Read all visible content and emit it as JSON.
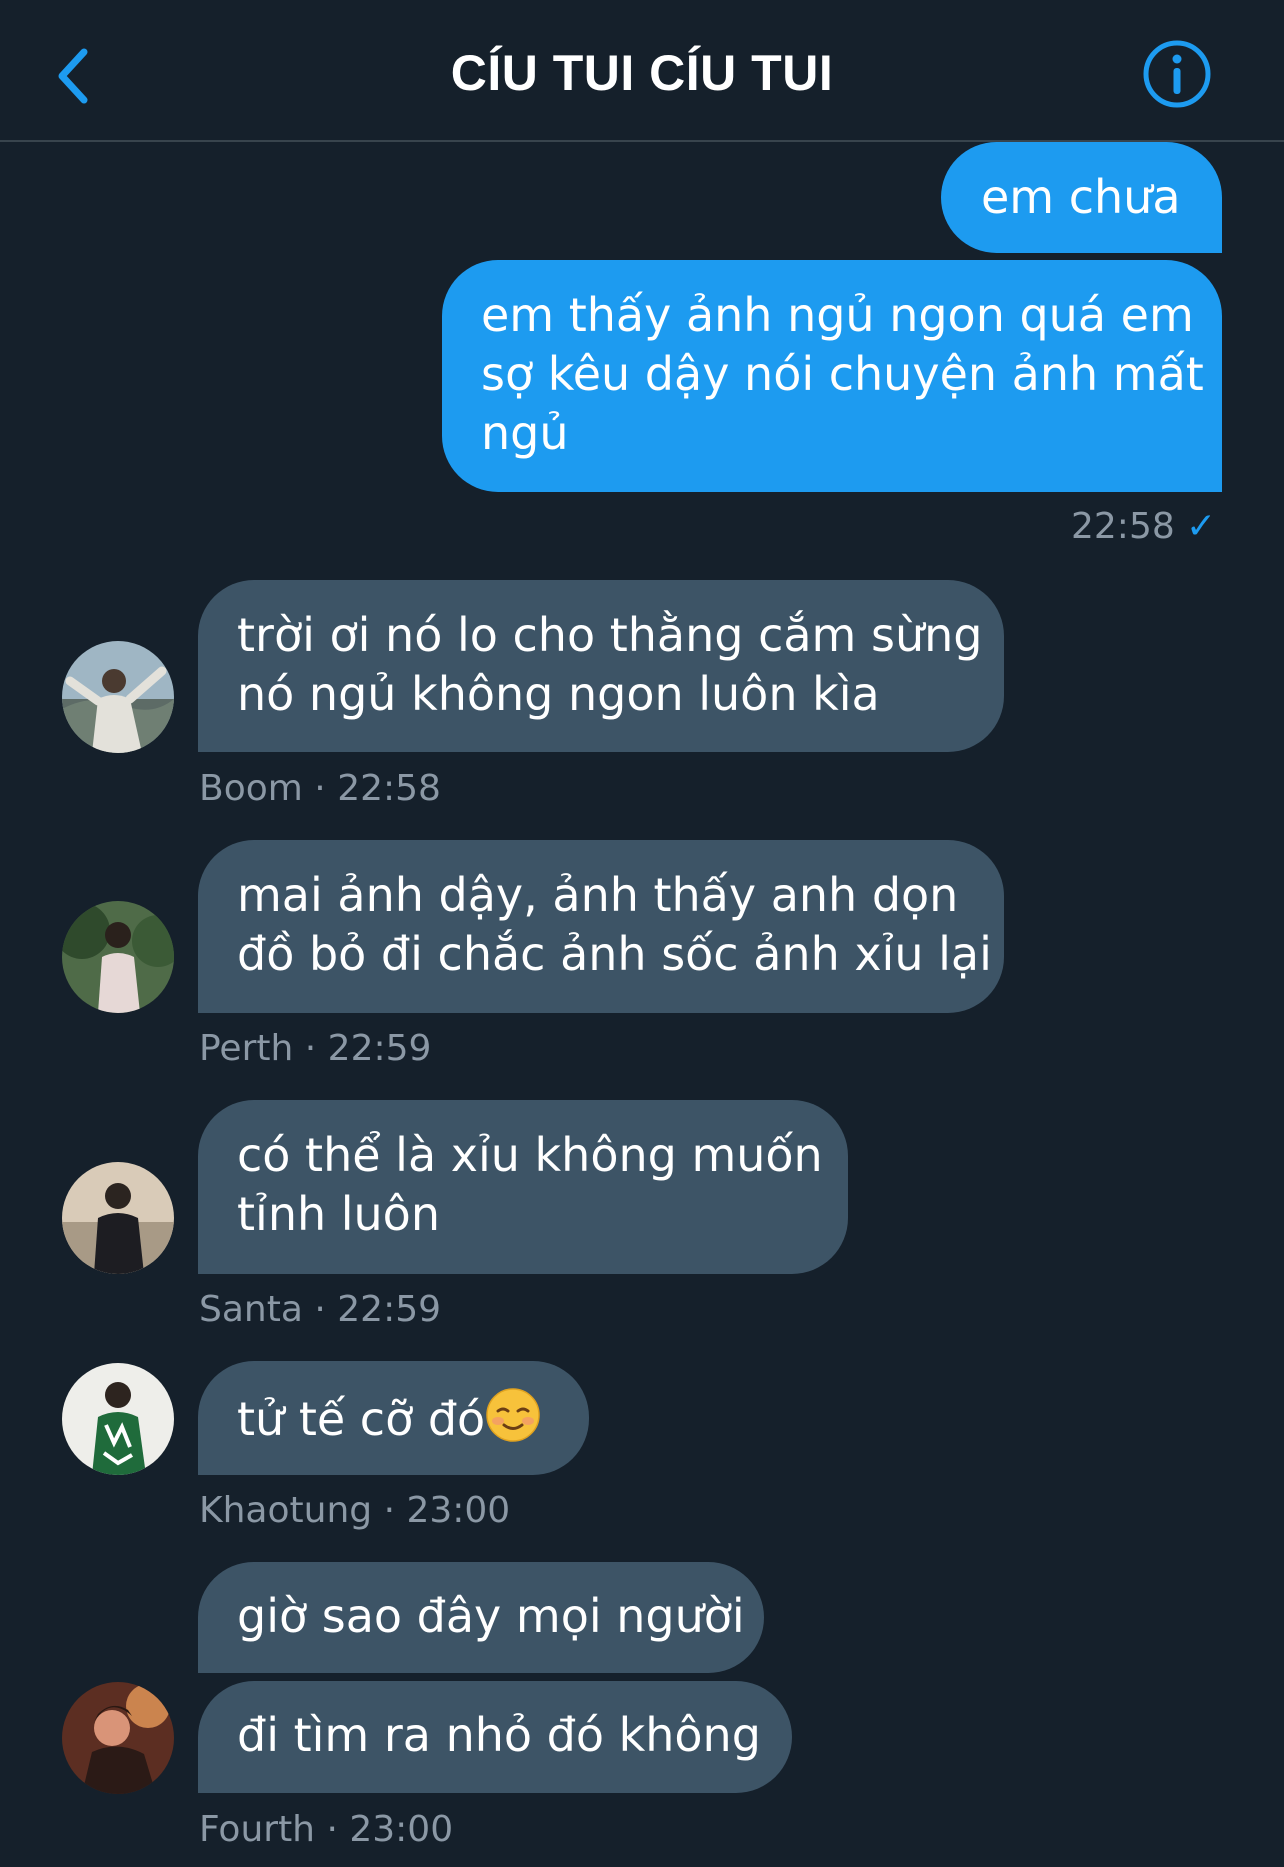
{
  "header": {
    "title": "CÍU TUI CÍU TUI"
  },
  "icons": {
    "back": "chevron-left-icon",
    "info": "info-circle-icon"
  },
  "colors": {
    "background": "#15202b",
    "outgoing": "#1d9bf0",
    "incoming": "#3d5466",
    "meta": "#8b98a5"
  },
  "outgoing": {
    "messages": [
      {
        "text": "em chưa"
      },
      {
        "line1": "em thấy ảnh ngủ ngon quá em",
        "line2": "sợ kêu dậy nói chuyện ảnh mất",
        "line3": "ngủ"
      }
    ],
    "time": "22:58",
    "read_mark": "✓"
  },
  "incoming": [
    {
      "line1": "trời ơi nó lo cho thằng cắm sừng",
      "line2": "nó ngủ không ngon luôn kìa",
      "sender": "Boom",
      "time": "22:58"
    },
    {
      "line1": "mai ảnh dậy, ảnh thấy anh dọn",
      "line2": "đồ bỏ đi chắc ảnh sốc ảnh xỉu lại",
      "sender": "Perth",
      "time": "22:59"
    },
    {
      "line1": "có thể là xỉu không muốn",
      "line2": "tỉnh luôn",
      "sender": "Santa",
      "time": "22:59"
    },
    {
      "line1": "tử tế cỡ đó",
      "emoji": "smiling-face-icon",
      "sender": "Khaotung",
      "time": "23:00"
    },
    {
      "msg1": "giờ sao đây mọi người",
      "msg2": "đi tìm ra nhỏ đó không",
      "sender": "Fourth",
      "time": "23:00"
    }
  ],
  "separator": "·"
}
